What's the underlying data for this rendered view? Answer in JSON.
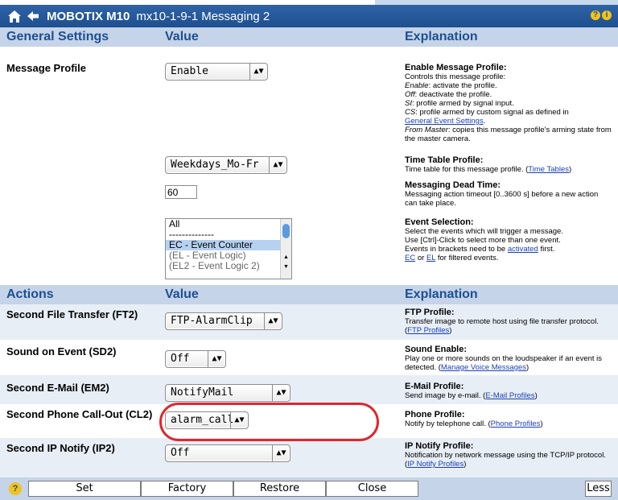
{
  "title": {
    "product": "MOBOTIX M10",
    "page": "mx10-1-9-1 Messaging 2"
  },
  "headers1": {
    "col1": "General Settings",
    "col2": "Value",
    "col3": "Explanation"
  },
  "headers2": {
    "col1": "Actions",
    "col2": "Value",
    "col3": "Explanation"
  },
  "profile": {
    "label": "Message Profile",
    "enable_value": "Enable",
    "timetable_value": "Weekdays_Mo-Fr",
    "deadtime_value": "60",
    "events": [
      "All",
      "--------------",
      "EC - Event Counter",
      "(EL - Event Logic)",
      "(EL2 - Event Logic 2)"
    ],
    "exp_enable_title": "Enable Message Profile",
    "exp_enable_l1": "Controls this message profile:",
    "exp_enable_l2a": "Enable",
    "exp_enable_l2b": ": activate the profile.",
    "exp_enable_l3a": "Off",
    "exp_enable_l3b": ": deactivate the profile.",
    "exp_enable_l4a": "SI",
    "exp_enable_l4b": ": profile armed by signal input.",
    "exp_enable_l5a": "CS",
    "exp_enable_l5b": ": profile armed by custom signal as defined in",
    "exp_enable_l6": "General Event Settings",
    "exp_enable_l7a": "From Master",
    "exp_enable_l7b": ": copies this message profile's arming state from the master camera.",
    "exp_tt_title": "Time Table Profile",
    "exp_tt_text": "Time table for this message profile. (",
    "exp_tt_link": "Time Tables",
    "exp_dt_title": "Messaging Dead Time",
    "exp_dt_text": "Messaging action timeout [0..3600 s] before a new action can take place.",
    "exp_ev_title": "Event Selection",
    "exp_ev_l1": "Select the events which will trigger a message.",
    "exp_ev_l2": "Use [Ctrl]-Click to select more than one event.",
    "exp_ev_l3": "Events in brackets need to be ",
    "exp_ev_l3link": "activated",
    "exp_ev_l3end": " first.",
    "exp_ev_l4a": "EC",
    "exp_ev_l4mid": " or ",
    "exp_ev_l4b": "EL",
    "exp_ev_l4end": " for filtered events."
  },
  "actions": [
    {
      "label": "Second File Transfer (FT2)",
      "value": "FTP-AlarmClip",
      "exp_title": "FTP Profile",
      "exp_text": "Transfer image to remote host using file transfer protocol. (",
      "exp_link": "FTP Profiles"
    },
    {
      "label": "Sound on Event (SD2)",
      "value": "Off",
      "exp_title": "Sound Enable",
      "exp_text": "Play one or more sounds on the loudspeaker if an event is detected. (",
      "exp_link": "Manage Voice Messages"
    },
    {
      "label": "Second E-Mail (EM2)",
      "value": "NotifyMail",
      "exp_title": "E-Mail Profile",
      "exp_text": "Send image by e-mail. (",
      "exp_link": "E-Mail Profiles"
    },
    {
      "label": "Second Phone Call-Out (CL2)",
      "value": "alarm_call",
      "exp_title": "Phone Profile",
      "exp_text": "Notify by telephone call. (",
      "exp_link": "Phone Profiles"
    },
    {
      "label": "Second IP Notify (IP2)",
      "value": "Off",
      "exp_title": "IP Notify Profile",
      "exp_text": "Notification by network message using the TCP/IP protocol. (",
      "exp_link": "IP Notify Profiles"
    }
  ],
  "footer": {
    "set": "Set",
    "factory": "Factory",
    "restore": "Restore",
    "close": "Close",
    "less": "Less"
  },
  "colors": {
    "titlebar": "#1e4f8f",
    "header_bg": "#c5d4e8",
    "header_text": "#1d4f92",
    "highlight_ring": "#e0262c"
  },
  "icons": [
    "home-icon",
    "back-arrow-icon",
    "help-icon",
    "info-icon"
  ]
}
